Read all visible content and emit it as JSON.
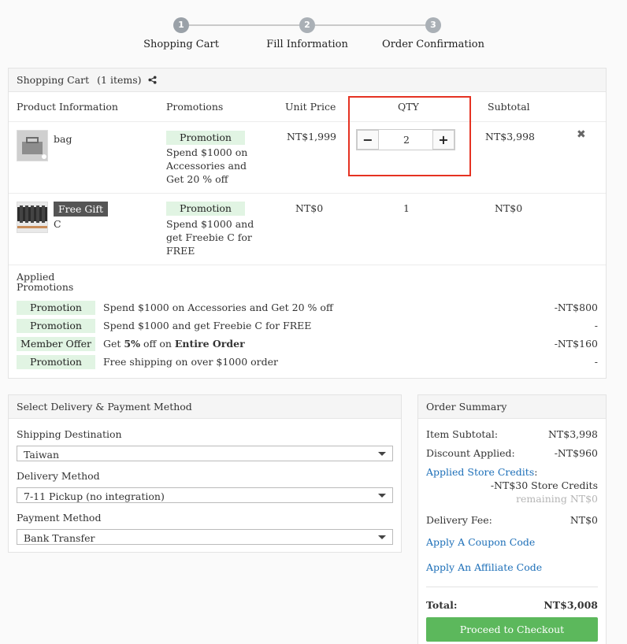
{
  "steps": [
    {
      "number": "1",
      "label": "Shopping Cart"
    },
    {
      "number": "2",
      "label": "Fill Information"
    },
    {
      "number": "3",
      "label": "Order Confirmation"
    }
  ],
  "cart": {
    "title": "Shopping Cart",
    "count_text": "(1 items)",
    "columns": [
      "Product Information",
      "Promotions",
      "Unit Price",
      "QTY",
      "Subtotal"
    ],
    "items": [
      {
        "name": "bag",
        "promo_badge": "Promotion",
        "promo_text": [
          "Spend $1000 on",
          "Accessories and",
          "Get 20 % off"
        ],
        "unit_price": "NT$1,999",
        "qty": "2",
        "subtotal": "NT$3,998"
      },
      {
        "gift_badge": "Free Gift",
        "name": "C",
        "promo_badge": "Promotion",
        "promo_text": [
          "Spend $1000 and",
          "get Freebie C for",
          "FREE"
        ],
        "unit_price": "NT$0",
        "qty": "1",
        "subtotal": "NT$0"
      }
    ],
    "applied_title": [
      "Applied",
      "Promotions"
    ],
    "applied": [
      {
        "badge": "Promotion",
        "text": "Spend $1000 on Accessories and Get 20 % off",
        "value": "-NT$800"
      },
      {
        "badge": "Promotion",
        "text": "Spend $1000 and get Freebie C for FREE",
        "value": "-"
      },
      {
        "badge": "Member Offer",
        "text_pre": "Get ",
        "text_bold1": "5%",
        "text_mid": " off on ",
        "text_bold2": "Entire Order",
        "value": "-NT$160"
      },
      {
        "badge": "Promotion",
        "text": "Free shipping on over $1000 order",
        "value": "-"
      }
    ]
  },
  "delivery": {
    "title": "Select Delivery & Payment Method",
    "shipping_label": "Shipping Destination",
    "shipping_value": "Taiwan",
    "method_label": "Delivery Method",
    "method_value": "7-11 Pickup (no integration)",
    "payment_label": "Payment Method",
    "payment_value": "Bank Transfer"
  },
  "summary": {
    "title": "Order Summary",
    "item_subtotal_label": "Item Subtotal:",
    "item_subtotal": "NT$3,998",
    "discount_label": "Discount Applied:",
    "discount": "-NT$960",
    "store_credits_link": "Applied Store Credits",
    "store_credits_colon": ":",
    "store_credits_value": "-NT$30 Store Credits",
    "remaining": "remaining NT$0",
    "delivery_fee_label": "Delivery Fee:",
    "delivery_fee": "NT$0",
    "coupon_link": "Apply A Coupon Code",
    "affiliate_link": "Apply An Affiliate Code",
    "total_label": "Total:",
    "total": "NT$3,008",
    "checkout_label": "Proceed to Checkout"
  },
  "colors": {
    "accent_green": "#5cb85c",
    "promo_bg": "#e1f4e3",
    "link_blue": "#1d6fb8",
    "highlight_red": "#e53222"
  }
}
